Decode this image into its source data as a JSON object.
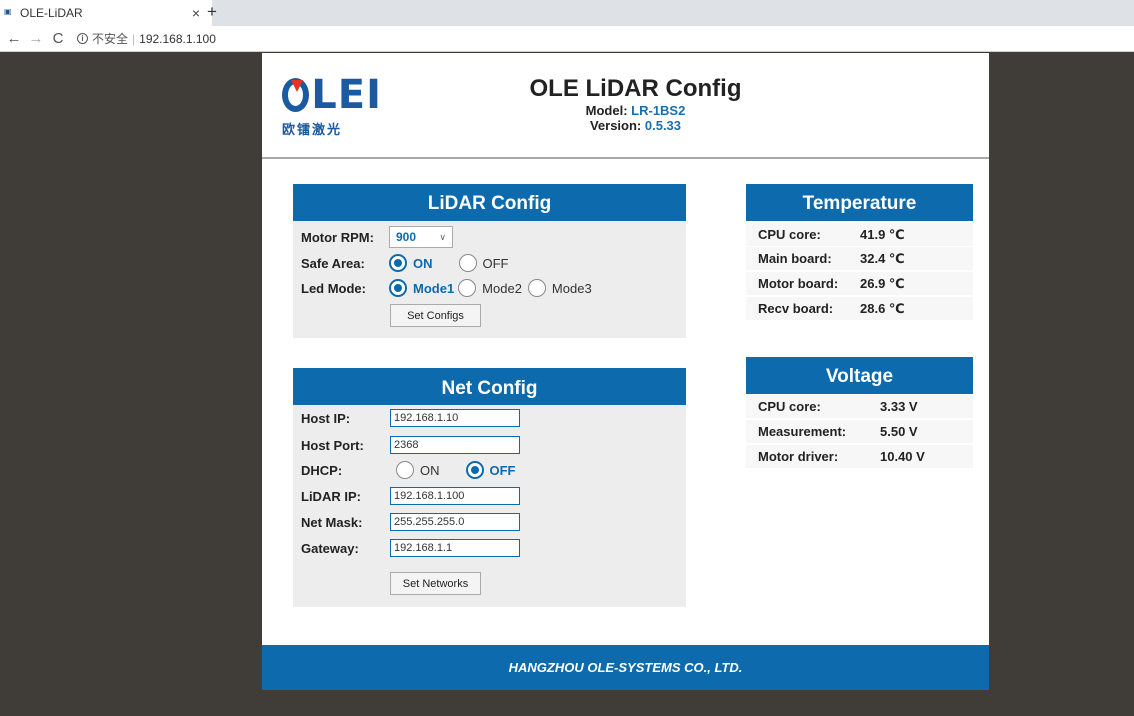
{
  "browser": {
    "tab_title": "OLE-LiDAR",
    "tab_close": "×",
    "new_tab": "+",
    "back": "←",
    "forward": "→",
    "reload": "C",
    "security_label": "不安全",
    "url": "192.168.1.100"
  },
  "header": {
    "logo_text": "LEI",
    "logo_cn": "欧镭激光",
    "title": "OLE LiDAR Config",
    "model_label": "Model:",
    "model": "LR-1BS2",
    "version_label": "Version:",
    "version": "0.5.33"
  },
  "lidar_config": {
    "title": "LiDAR Config",
    "motor_rpm_label": "Motor RPM:",
    "motor_rpm": "900",
    "safe_area_label": "Safe Area:",
    "safe_area_options": [
      "ON",
      "OFF"
    ],
    "safe_area_selected": "ON",
    "led_mode_label": "Led Mode:",
    "led_mode_options": [
      "Mode1",
      "Mode2",
      "Mode3"
    ],
    "led_mode_selected": "Mode1",
    "set_button": "Set Configs"
  },
  "net_config": {
    "title": "Net Config",
    "host_ip_label": "Host IP:",
    "host_ip": "192.168.1.10",
    "host_port_label": "Host Port:",
    "host_port": "2368",
    "dhcp_label": "DHCP:",
    "dhcp_options": [
      "ON",
      "OFF"
    ],
    "dhcp_selected": "OFF",
    "lidar_ip_label": "LiDAR IP:",
    "lidar_ip": "192.168.1.100",
    "net_mask_label": "Net Mask:",
    "net_mask": "255.255.255.0",
    "gateway_label": "Gateway:",
    "gateway": "192.168.1.1",
    "set_button": "Set Networks"
  },
  "temperature": {
    "title": "Temperature",
    "rows": [
      {
        "label": "CPU core:",
        "value": "41.9 ℃"
      },
      {
        "label": "Main board:",
        "value": "32.4 ℃"
      },
      {
        "label": "Motor board:",
        "value": "26.9 ℃"
      },
      {
        "label": "Recv board:",
        "value": "28.6 ℃"
      }
    ]
  },
  "voltage": {
    "title": "Voltage",
    "rows": [
      {
        "label": "CPU core:",
        "value": "3.33 V"
      },
      {
        "label": "Measurement:",
        "value": "5.50 V"
      },
      {
        "label": "Motor driver:",
        "value": "10.40 V"
      }
    ]
  },
  "footer": {
    "text": "HANGZHOU OLE-SYSTEMS CO., LTD."
  },
  "colors": {
    "accent": "#0d6aad",
    "background": "#403d38",
    "panel": "#ededed"
  }
}
